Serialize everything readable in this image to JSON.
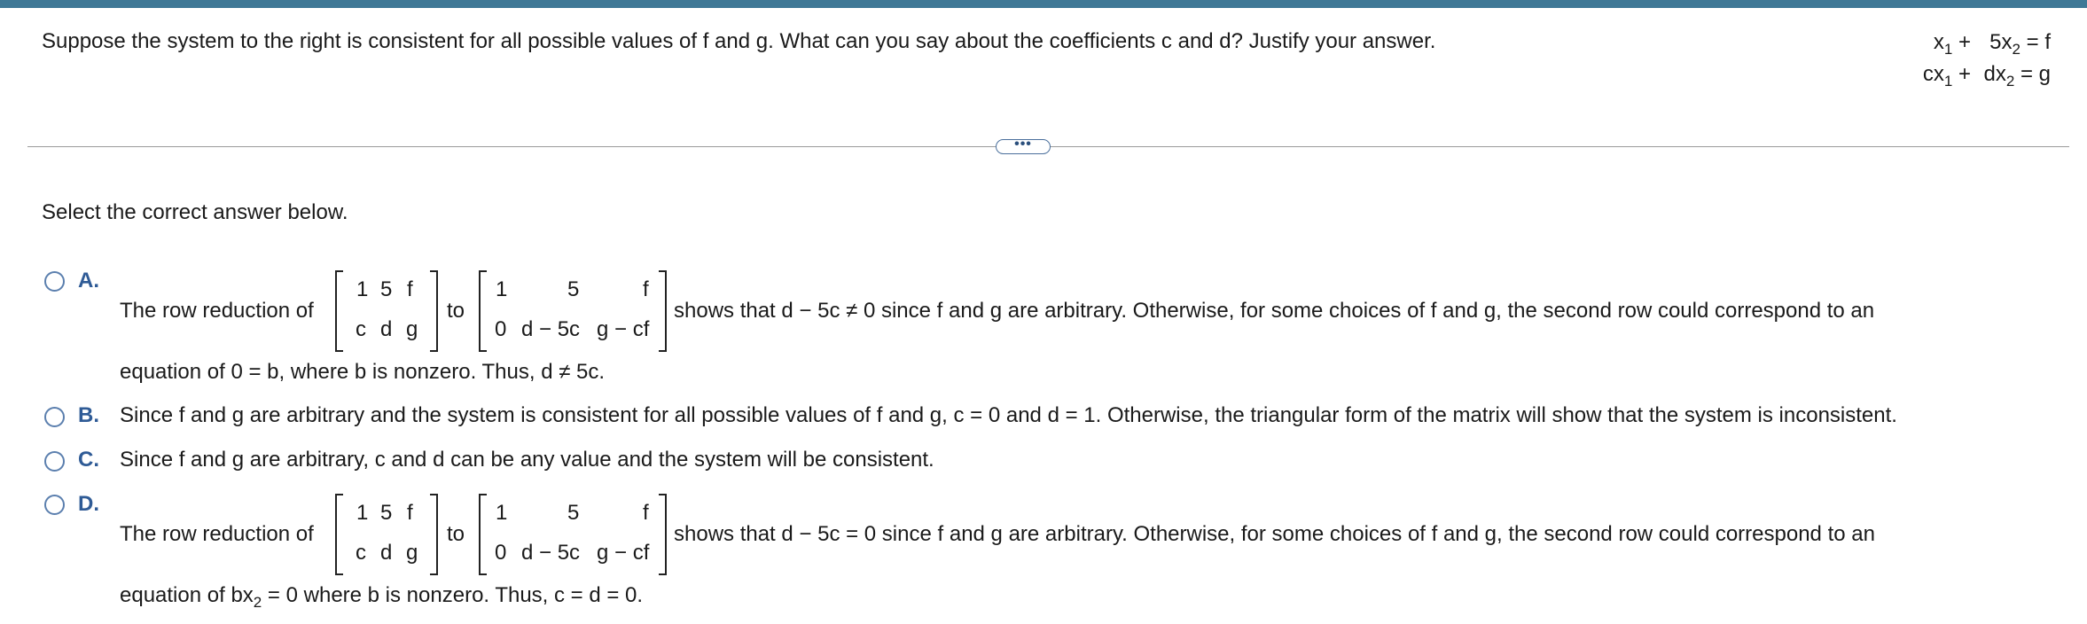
{
  "question": "Suppose the system to the right is consistent for all possible values of f and g. What can you say about the coefficients c and d? Justify your answer.",
  "system": {
    "row1": {
      "left": "x",
      "left_sub": "1",
      "left_op": " +",
      "right": "5x",
      "right_sub": "2",
      "right_eq": " = f"
    },
    "row2": {
      "left": "cx",
      "left_sub": "1",
      "left_op": " +",
      "right": "dx",
      "right_sub": "2",
      "right_eq": " = g"
    }
  },
  "more_button": "•••",
  "prompt": "Select the correct answer below.",
  "matrix_left": {
    "r1": [
      "1",
      "5",
      "f"
    ],
    "r2": [
      "c",
      "d",
      "g"
    ]
  },
  "matrix_right": {
    "r1": [
      "1",
      "5",
      "f"
    ],
    "r2": [
      "0",
      "d − 5c",
      "g − cf"
    ]
  },
  "options": {
    "a": {
      "letter": "A.",
      "pre": "The row reduction of",
      "to": "to",
      "post": "shows that d − 5c ≠ 0 since f and g are arbitrary. Otherwise, for some choices of f and g, the second row could correspond to an",
      "line2": "equation of 0 = b, where b is nonzero. Thus, d ≠ 5c."
    },
    "b": {
      "letter": "B.",
      "text": "Since f and g are arbitrary and the system is consistent for all possible values of f and g, c = 0 and d = 1. Otherwise, the triangular form of the matrix will show that the system is inconsistent."
    },
    "c": {
      "letter": "C.",
      "text": "Since f and g are arbitrary, c and d can be any value and the system will be consistent."
    },
    "d": {
      "letter": "D.",
      "pre": "The row reduction of",
      "to": "to",
      "post": "shows that d − 5c = 0 since f and g are arbitrary. Otherwise, for some choices of f and g, the second row could correspond to an",
      "line2_a": "equation of bx",
      "line2_sub": "2",
      "line2_b": " = 0 where b is nonzero. Thus, c = d = 0."
    }
  }
}
